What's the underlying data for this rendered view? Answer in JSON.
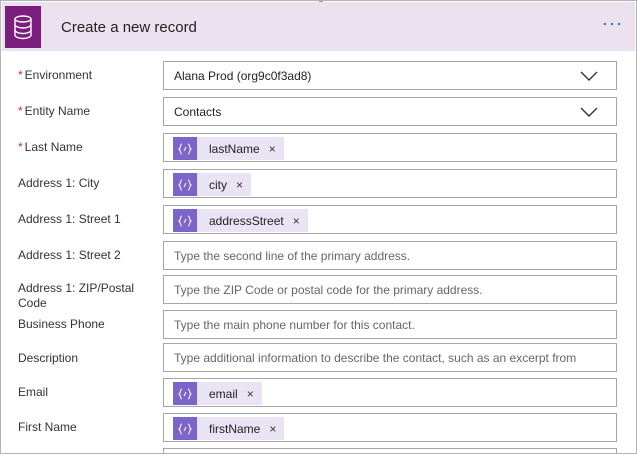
{
  "header": {
    "title": "Create a new record",
    "more_label": "···"
  },
  "fields": [
    {
      "label": "Environment",
      "required": "*",
      "value": "Alana Prod (org9c0f3ad8)"
    },
    {
      "label": "Entity Name",
      "required": "*",
      "value": "Contacts"
    },
    {
      "label": "Last Name",
      "required": "*",
      "token": "lastName"
    },
    {
      "label": "Address 1: City",
      "token": "city"
    },
    {
      "label": "Address 1: Street 1",
      "token": "addressStreet"
    },
    {
      "label": "Address 1: Street 2",
      "placeholder": "Type the second line of the primary address."
    },
    {
      "label": "Address 1: ZIP/Postal Code",
      "placeholder": "Type the ZIP Code or postal code for the primary address."
    },
    {
      "label": "Business Phone",
      "placeholder": "Type the main phone number for this contact."
    },
    {
      "label": "Description",
      "placeholder": "Type additional information to describe the contact, such as an excerpt from"
    },
    {
      "label": "Email",
      "token": "email"
    },
    {
      "label": "First Name",
      "token": "firstName"
    }
  ],
  "token_remove_glyph": "×",
  "colors": {
    "header_bg": "#ece1ee",
    "connector_icon_bg": "#7b1f7e",
    "token_icon_bg": "#7b65c9",
    "token_bg": "#e9e3f3",
    "more_dots": "#0b62c5",
    "required_star": "#c0392b"
  },
  "icons": {
    "connector": "database-icon",
    "token": "expression-icon",
    "dropdown": "chevron-down-icon",
    "more": "more-options-icon"
  }
}
